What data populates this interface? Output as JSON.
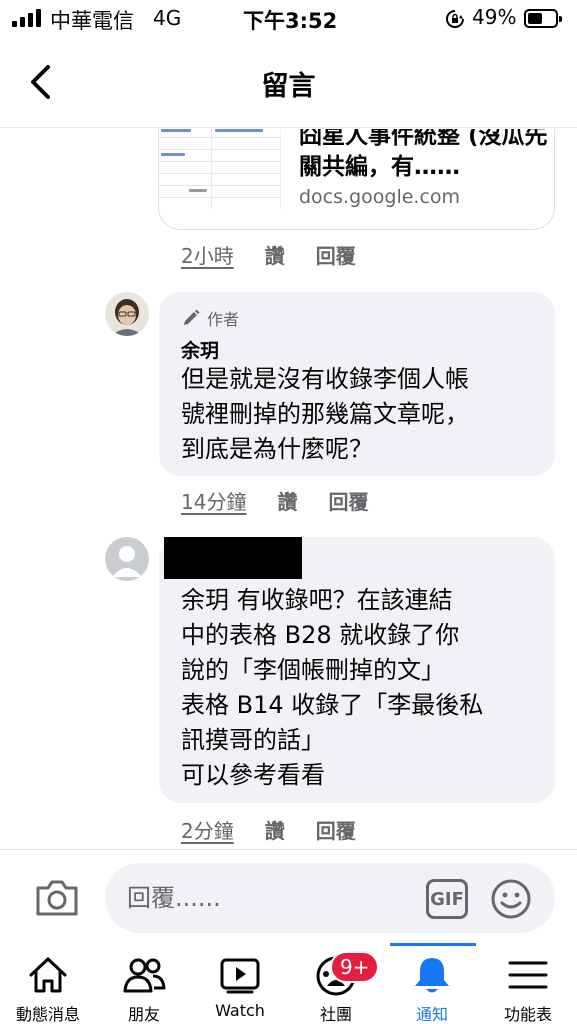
{
  "status_bar": {
    "carrier": "中華電信",
    "network": "4G",
    "time": "下午3:52",
    "battery": "49%"
  },
  "header": {
    "title": "留言"
  },
  "link_preview": {
    "title": "囧星人事件統整 (沒瓜先關共編，有……",
    "domain": "docs.google.com"
  },
  "comments": [
    {
      "time": "2小時",
      "like": "讚",
      "reply": "回覆"
    },
    {
      "badge": "作者",
      "name": "余玥",
      "text": "但是就是沒有收錄李個人帳\n號裡刪掉的那幾篇文章呢，\n到底是為什麼呢？",
      "time": "14分鐘",
      "like": "讚",
      "reply": "回覆"
    },
    {
      "text": "余玥 有收錄吧？在該連結\n中的表格 B28 就收錄了你\n說的「李個帳刪掉的文」\n表格 B14 收錄了「李最後私\n訊摸哥的話」\n可以參考看看",
      "time": "2分鐘",
      "like": "讚",
      "reply": "回覆"
    }
  ],
  "composer": {
    "placeholder": "回覆......",
    "gif": "GIF"
  },
  "tabbar": {
    "items": [
      {
        "label": "動態消息",
        "icon": "home-icon"
      },
      {
        "label": "朋友",
        "icon": "friends-icon"
      },
      {
        "label": "Watch",
        "icon": "watch-icon"
      },
      {
        "label": "社團",
        "icon": "groups-icon"
      },
      {
        "label": "通知",
        "icon": "bell-icon"
      },
      {
        "label": "功能表",
        "icon": "menu-icon"
      }
    ],
    "groups_badge": "9+",
    "active": "通知"
  },
  "colors": {
    "accent": "#1877f2",
    "bubble": "#f0f2f5",
    "secondary_text": "#65676b",
    "badge": "#e41e3f"
  }
}
